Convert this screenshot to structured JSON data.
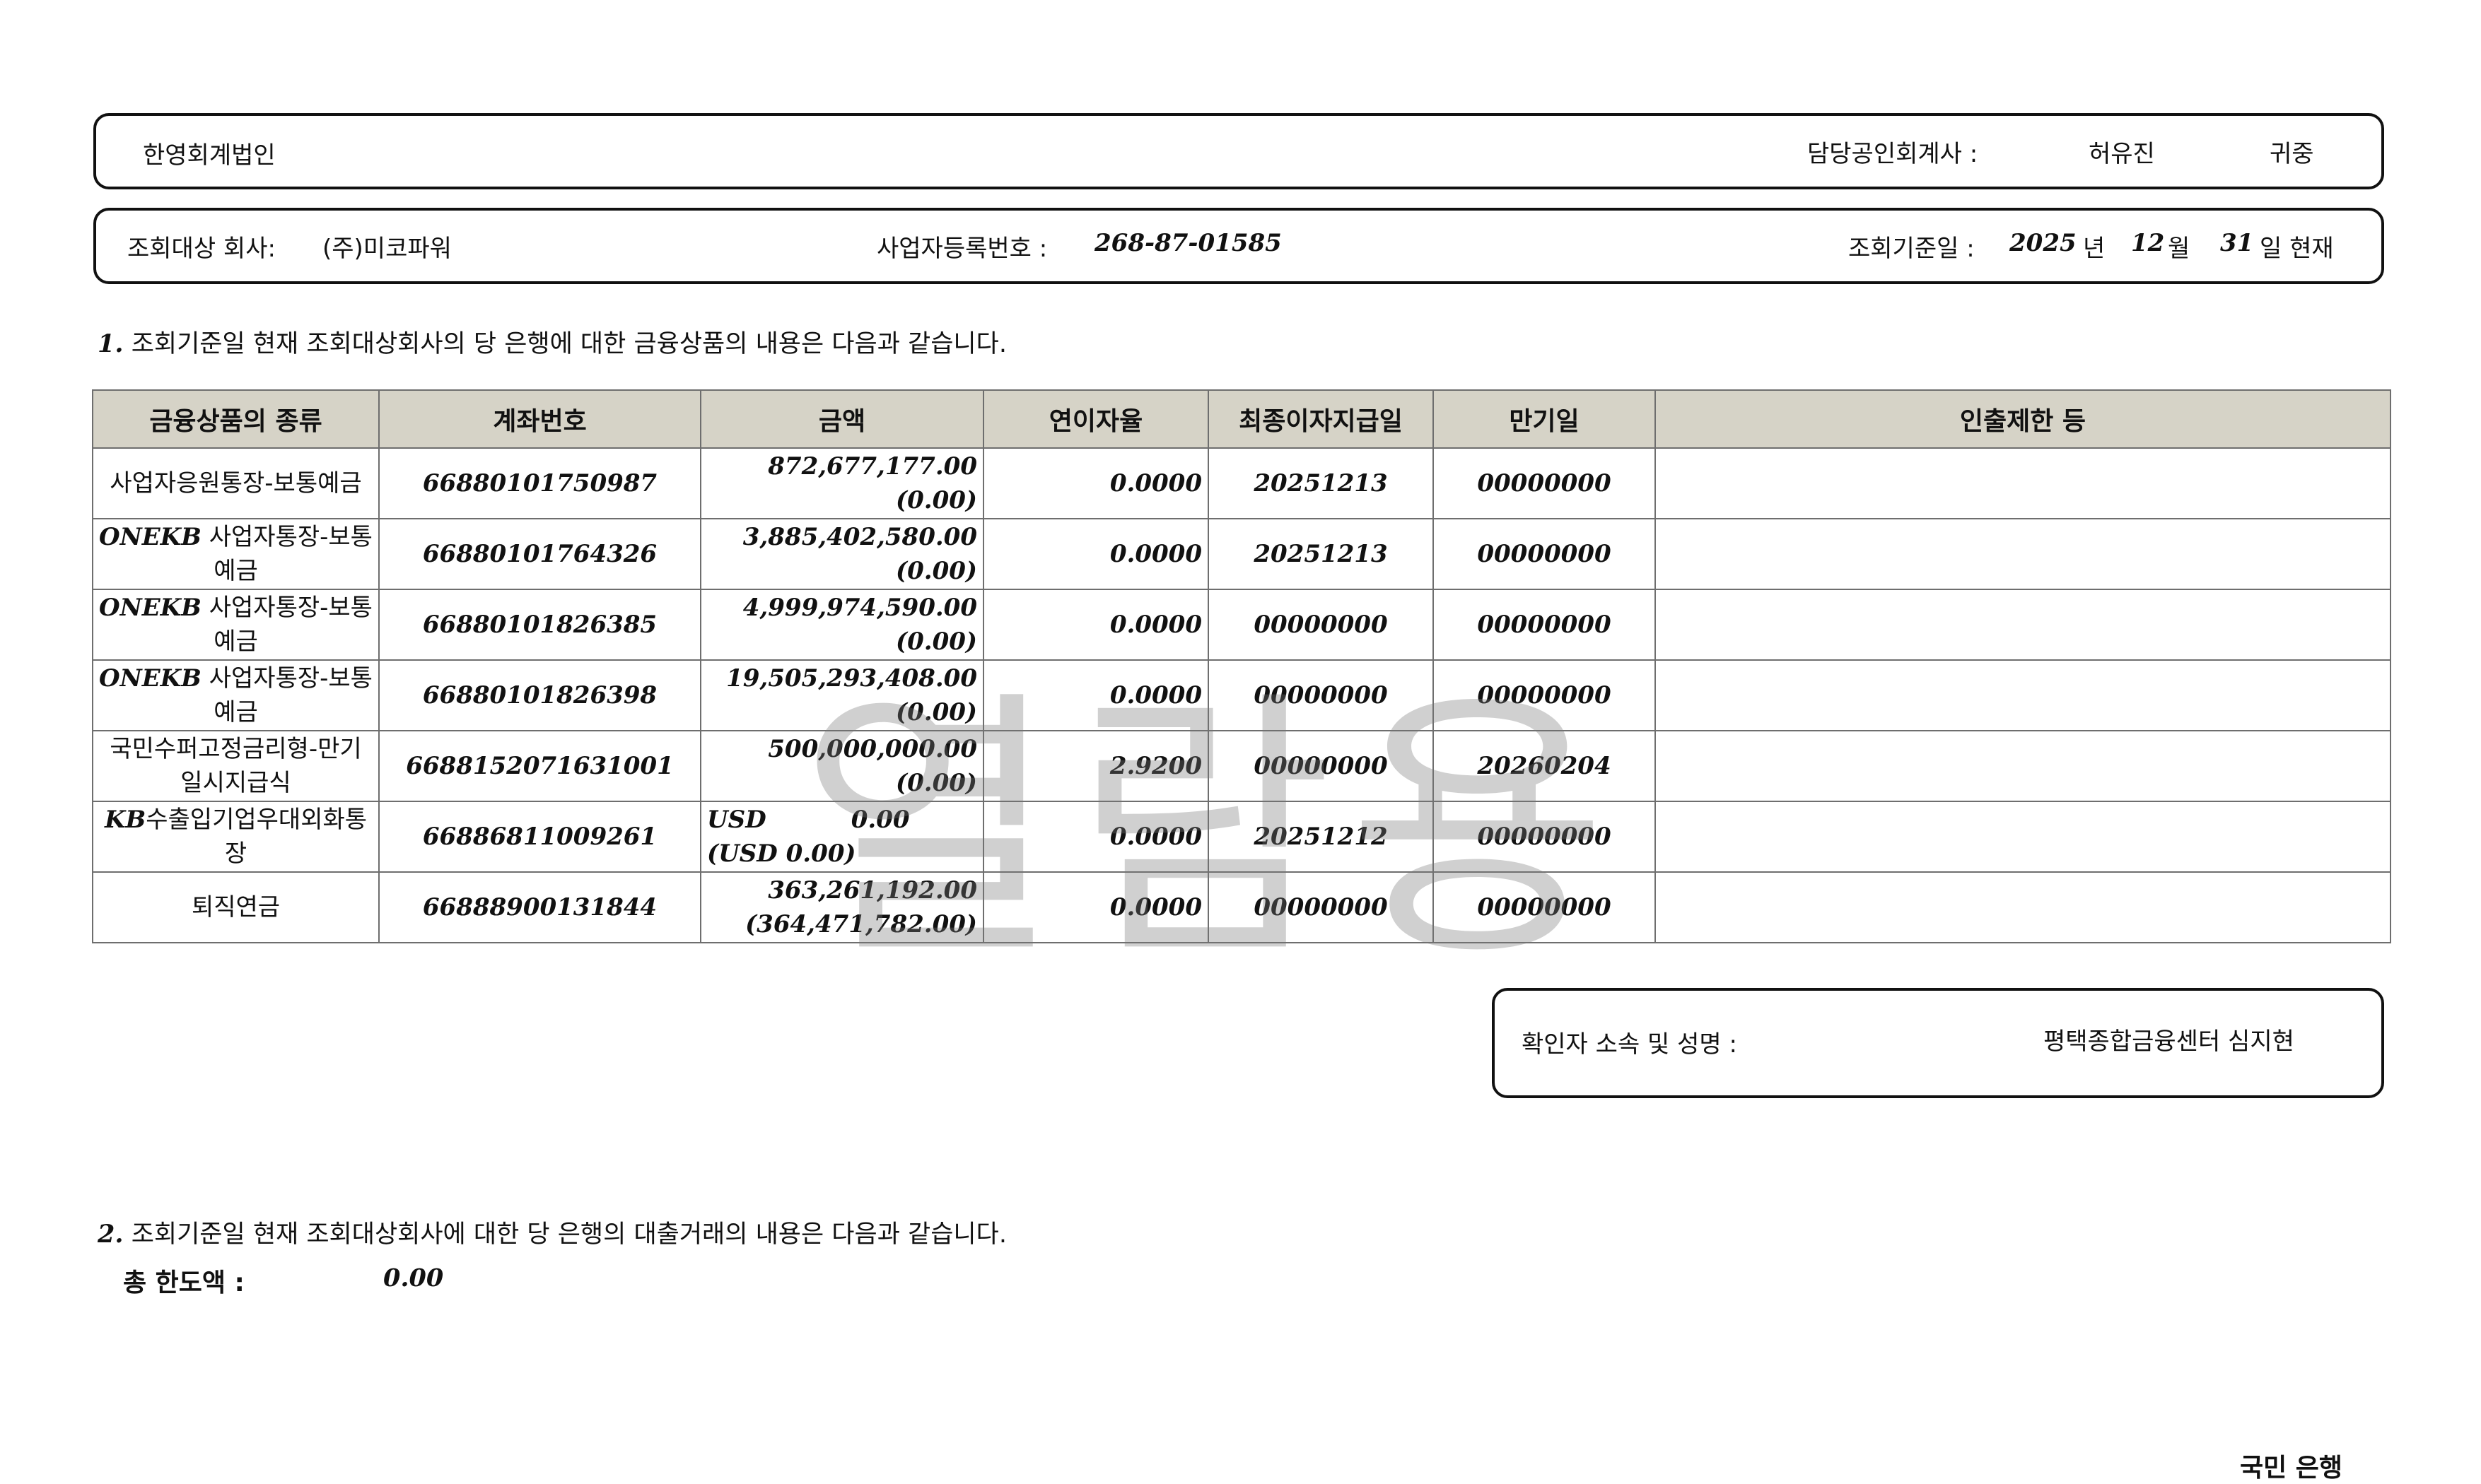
{
  "header": {
    "firm": "한영회계법인",
    "cpa_label": "담당공인회계사 :",
    "cpa_name": "허유진",
    "honorific": "귀중"
  },
  "company_bar": {
    "company_label": "조회대상 회사:",
    "company_name": "(주)미코파워",
    "regno_label": "사업자등록번호 :",
    "regno": "268-87-01585",
    "date_label": "조회기준일 :",
    "year": "2025",
    "year_unit": "년",
    "month": "12",
    "month_unit": "월",
    "day": "31",
    "day_unit": "일 현재"
  },
  "section1": {
    "num": "1.",
    "text": "조회기준일 현재 조회대상회사의 당 은행에 대한 금융상품의 내용은 다음과 같습니다."
  },
  "table": {
    "headers": [
      "금융상품의 종류",
      "계좌번호",
      "금액",
      "연이자율",
      "최종이자지급일",
      "만기일",
      "인출제한 등"
    ],
    "rows": [
      {
        "kind_prefix": "",
        "kind": "사업자응원통장-보통예금",
        "account": "66880101750987",
        "amount": "872,677,177.00 (0.00)",
        "rate": "0.0000",
        "last_interest": "20251213",
        "maturity": "00000000",
        "restriction": ""
      },
      {
        "kind_prefix": "ONEKB",
        "kind": " 사업자통장-보통예금",
        "account": "66880101764326",
        "amount": "3,885,402,580.00 (0.00)",
        "rate": "0.0000",
        "last_interest": "20251213",
        "maturity": "00000000",
        "restriction": ""
      },
      {
        "kind_prefix": "ONEKB",
        "kind": " 사업자통장-보통예금",
        "account": "66880101826385",
        "amount": "4,999,974,590.00 (0.00)",
        "rate": "0.0000",
        "last_interest": "00000000",
        "maturity": "00000000",
        "restriction": ""
      },
      {
        "kind_prefix": "ONEKB",
        "kind": " 사업자통장-보통예금",
        "account": "66880101826398",
        "amount": "19,505,293,408.00 (0.00)",
        "rate": "0.0000",
        "last_interest": "00000000",
        "maturity": "00000000",
        "restriction": ""
      },
      {
        "kind_prefix": "",
        "kind": "국민수퍼고정금리형-만기일시지급식",
        "account": "6688152071631001",
        "amount": "500,000,000.00 (0.00)",
        "rate": "2.9200",
        "last_interest": "00000000",
        "maturity": "20260204",
        "restriction": ""
      },
      {
        "kind_prefix": "KB",
        "kind": "수출입기업우대외화통장",
        "account": "66886811009261",
        "currency": "USD",
        "amount": "0.00 (USD 0.00)",
        "rate": "0.0000",
        "last_interest": "20251212",
        "maturity": "00000000",
        "restriction": ""
      },
      {
        "kind_prefix": "",
        "kind": "퇴직연금",
        "account": "66888900131844",
        "amount": "363,261,192.00 (364,471,782.00)",
        "rate": "0.0000",
        "last_interest": "00000000",
        "maturity": "00000000",
        "restriction": ""
      }
    ]
  },
  "confirm": {
    "label": "확인자 소속 및 성명 :",
    "name": "평택종합금융센터 심지현"
  },
  "section2": {
    "num": "2.",
    "text": "조회기준일 현재 조회대상회사에 대한 당 은행의 대출거래의 내용은 다음과 같습니다.",
    "limit_label": "총 한도액 :",
    "limit_value": "0.00"
  },
  "bank": "국민 은행",
  "watermark": "열람용"
}
